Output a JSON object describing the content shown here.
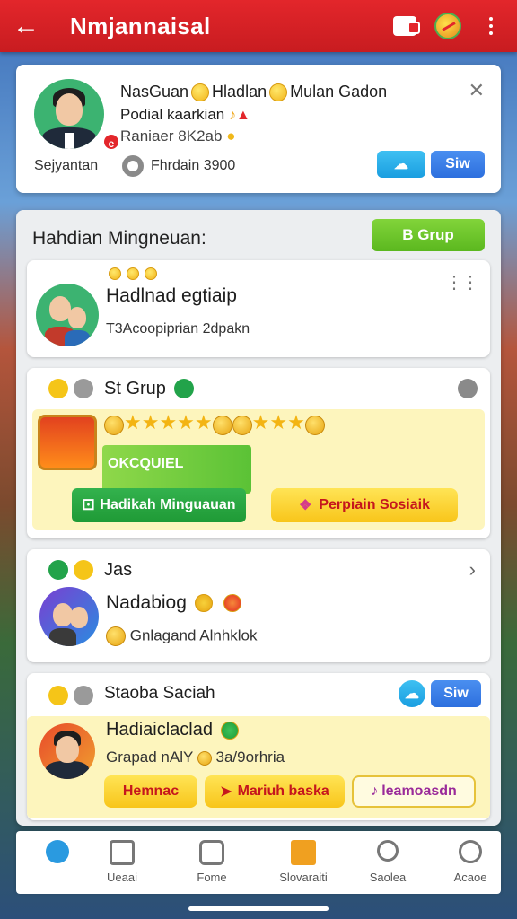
{
  "topbar": {
    "back_icon": "back-arrow-icon",
    "title": "Nmjannaisal",
    "icons": [
      "wallet-icon",
      "ball-icon",
      "more-vertical-icon"
    ]
  },
  "profile": {
    "name_line": "NasGuan",
    "name_line_b": "Hladlan",
    "name_line_c": "Mulan Gadon",
    "line2": "Podial kaarkian",
    "line3": "Raniaer",
    "line3_num": "8K2ab",
    "avatar_caption": "Sejyantan",
    "counter_label": "Fhrdain 3900",
    "blue_button_label": "Siw",
    "badge": "e"
  },
  "panel": {
    "heading": "Hahdian Mingneuan:",
    "group_button": "B Grup"
  },
  "card1": {
    "title": "Hadlnad egtiaip",
    "subtitle": "T3Acoopiprian 2dpakn"
  },
  "card2": {
    "title": "St Grup",
    "overlay_label": "OKCQUIEL",
    "green_button": "Hadikah Minguauan",
    "yellow_button": "Perpiain Sosiaik"
  },
  "card3": {
    "title": "Jas",
    "name": "Nadabiog",
    "detail": "Gnlagand Alnhklok"
  },
  "card4": {
    "title": "Staoba Saciah",
    "blue_button": "Siw",
    "name": "Hadiaiclaclad",
    "detail_a": "Grapad nAlY",
    "detail_b": "3a/9orhria",
    "btn_a": "Hemnac",
    "btn_b": "Mariuh baska",
    "btn_c": "leamoasdn"
  },
  "bottomnav": {
    "items": [
      {
        "label": "Ueaai",
        "icon": "home-icon"
      },
      {
        "label": "Fome",
        "icon": "chat-icon"
      },
      {
        "label": "Slovaraiti",
        "icon": "bookmark-icon"
      },
      {
        "label": "Saolea",
        "icon": "search-icon"
      },
      {
        "label": "Acaoe",
        "icon": "alert-icon"
      }
    ]
  },
  "colors": {
    "topbar": "#e3262b",
    "accent_green": "#5bb81f",
    "accent_blue": "#2d6fde",
    "highlight_yellow": "#fdf5bd"
  }
}
